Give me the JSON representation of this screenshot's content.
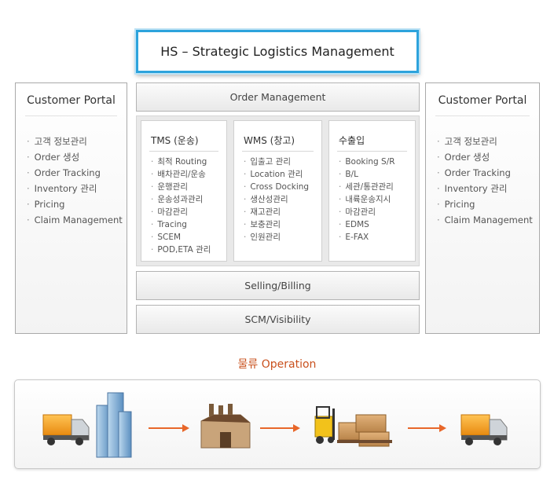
{
  "header": {
    "title": "HS – Strategic Logistics Management"
  },
  "left_portal": {
    "title": "Customer Portal",
    "items": [
      "고객 정보관리",
      "Order 생성",
      "Order Tracking",
      "Inventory 관리",
      "Pricing",
      "Claim Management"
    ]
  },
  "right_portal": {
    "title": "Customer Portal",
    "items": [
      "고객 정보관리",
      "Order 생성",
      "Order Tracking",
      "Inventory 관리",
      "Pricing",
      "Claim Management"
    ]
  },
  "center": {
    "order_management": "Order Management",
    "tms": {
      "title": "TMS (운송)",
      "items": [
        "최적 Routing",
        "배차관리/운송",
        "운행관리",
        "운송성과관리",
        "마감관리",
        "Tracing",
        "SCEM",
        "POD,ETA 관리"
      ]
    },
    "wms": {
      "title": "WMS (창고)",
      "items": [
        "입출고 관리",
        "Location 관리",
        "Cross Docking",
        "생산성관리",
        "재고관리",
        "보충관리",
        "인원관리"
      ]
    },
    "export": {
      "title": "수출입",
      "items": [
        "Booking S/R",
        "B/L",
        "세관/통관관리",
        "내륙운송지시",
        "마감관리",
        "EDMS",
        "E-FAX"
      ]
    },
    "selling_billing": "Selling/Billing",
    "scm_visibility": "SCM/Visibility"
  },
  "operation": {
    "label": "물류 Operation",
    "steps": [
      "truck-icon",
      "buildings-icon",
      "factory-icon",
      "forklift-pallets-icon",
      "truck-icon"
    ],
    "colors": {
      "truck": "#f5a21a",
      "arrow": "#e8672a",
      "accent": "#c9511e",
      "title_border": "#2da3dc"
    }
  }
}
